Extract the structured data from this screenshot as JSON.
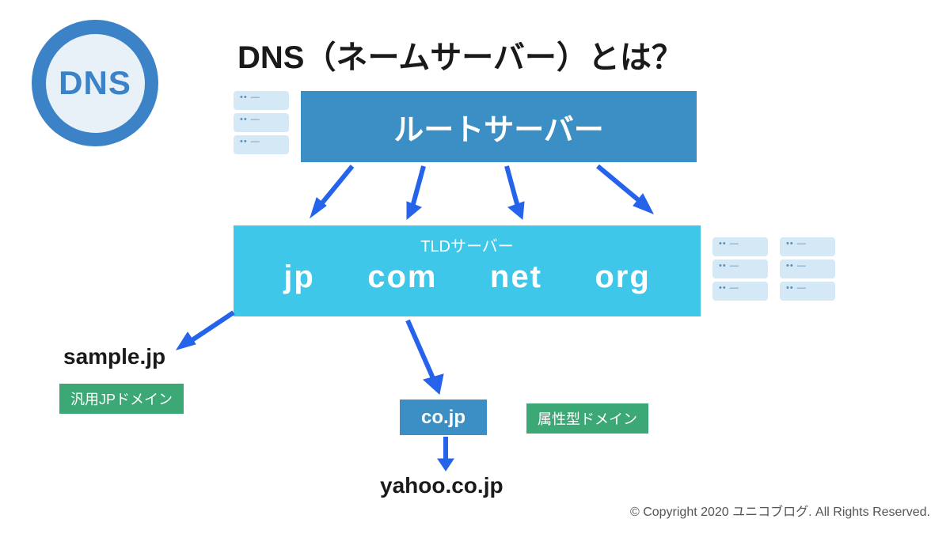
{
  "logo": {
    "text": "DNS"
  },
  "title": "DNS（ネームサーバー）とは？",
  "root_server": {
    "label": "ルートサーバー"
  },
  "tld_server": {
    "label": "TLDサーバー",
    "domains": [
      "jp",
      "com",
      "net",
      "org"
    ]
  },
  "second_level": {
    "cojp": "co.jp"
  },
  "examples": {
    "sample_jp": "sample.jp",
    "yahoo": "yahoo.co.jp"
  },
  "tags": {
    "generic_jp": "汎用JPドメイン",
    "attribute": "属性型ドメイン"
  },
  "copyright": "© Copyright 2020 ユニコブログ. All Rights Reserved."
}
